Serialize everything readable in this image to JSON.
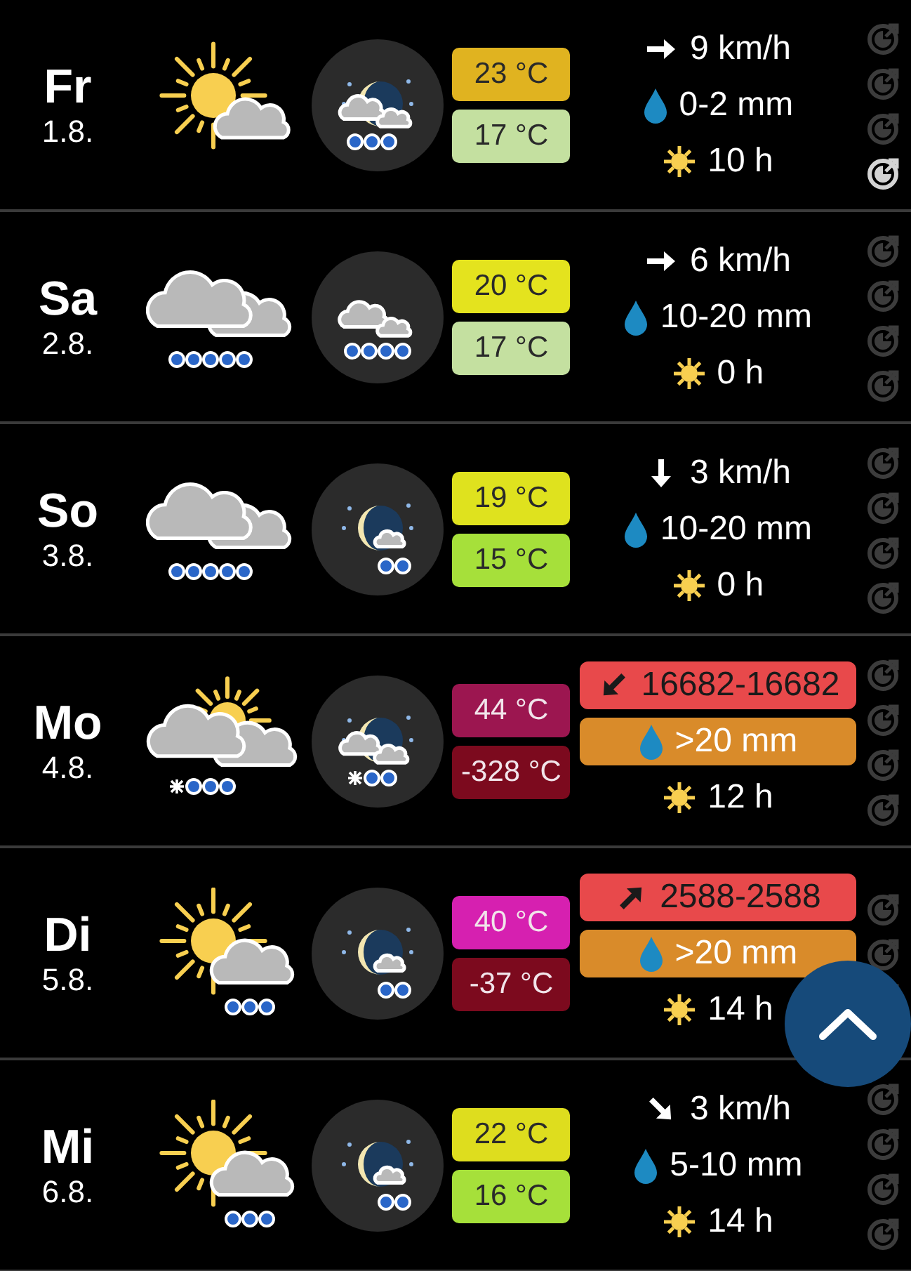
{
  "days": [
    {
      "day": "Fr",
      "date": "1.8.",
      "day_icon": {
        "kind": "sun_cloud"
      },
      "night_icon": {
        "kind": "moon_cloud_rain"
      },
      "high": {
        "text": "23 °C",
        "color": "#e0b320"
      },
      "low": {
        "text": "17 °C",
        "color": "#c4e0a0"
      },
      "wind": {
        "text": "9 km/h",
        "arrow": {
          "kind": "east"
        },
        "alert": false
      },
      "rain": {
        "text": "0-2 mm",
        "alert": false
      },
      "sun": "10 h",
      "markers": [
        {
          "selected": false
        },
        {
          "selected": false
        },
        {
          "selected": false
        },
        {
          "selected": true
        }
      ]
    },
    {
      "day": "Sa",
      "date": "2.8.",
      "day_icon": {
        "kind": "rain_cloud"
      },
      "night_icon": {
        "kind": "cloud_rain"
      },
      "high": {
        "text": "20 °C",
        "color": "#e4e31e"
      },
      "low": {
        "text": "17 °C",
        "color": "#c4e0a0"
      },
      "wind": {
        "text": "6 km/h",
        "arrow": {
          "kind": "east"
        },
        "alert": false
      },
      "rain": {
        "text": "10-20 mm",
        "alert": false
      },
      "sun": "0 h",
      "markers": [
        {
          "selected": false
        },
        {
          "selected": false
        },
        {
          "selected": false
        },
        {
          "selected": false
        }
      ]
    },
    {
      "day": "So",
      "date": "3.8.",
      "day_icon": {
        "kind": "rain_cloud"
      },
      "night_icon": {
        "kind": "moon_rain"
      },
      "high": {
        "text": "19 °C",
        "color": "#dfe21e"
      },
      "low": {
        "text": "15 °C",
        "color": "#a6e03a"
      },
      "wind": {
        "text": "3 km/h",
        "arrow": {
          "kind": "south"
        },
        "alert": false
      },
      "rain": {
        "text": "10-20 mm",
        "alert": false
      },
      "sun": "0 h",
      "markers": [
        {
          "selected": false
        },
        {
          "selected": false
        },
        {
          "selected": false
        },
        {
          "selected": false
        }
      ]
    },
    {
      "day": "Mo",
      "date": "4.8.",
      "day_icon": {
        "kind": "sun_cloud_snow"
      },
      "night_icon": {
        "kind": "moon_cloud_snow"
      },
      "high": {
        "text": "44 °C",
        "color": "#9c1650"
      },
      "low": {
        "text": "-328 °C",
        "color": "#7c0a1e"
      },
      "wind": {
        "text": "16682-16682",
        "arrow": {
          "kind": "southwest"
        },
        "alert": true
      },
      "rain": {
        "text": ">20 mm",
        "alert": true
      },
      "sun": "12 h",
      "markers": [
        {
          "selected": false
        },
        {
          "selected": false
        },
        {
          "selected": false
        },
        {
          "selected": false
        }
      ]
    },
    {
      "day": "Di",
      "date": "5.8.",
      "day_icon": {
        "kind": "sun_cloud_rain"
      },
      "night_icon": {
        "kind": "moon_rain"
      },
      "high": {
        "text": "40 °C",
        "color": "#d620b0"
      },
      "low": {
        "text": "-37 °C",
        "color": "#7c0a1e"
      },
      "wind": {
        "text": "2588-2588",
        "arrow": {
          "kind": "northeast"
        },
        "alert": true
      },
      "rain": {
        "text": ">20 mm",
        "alert": true
      },
      "sun": "14 h",
      "markers": [
        {
          "selected": false
        },
        {
          "selected": false
        },
        {
          "selected": false
        }
      ]
    },
    {
      "day": "Mi",
      "date": "6.8.",
      "day_icon": {
        "kind": "sun_cloud_rain"
      },
      "night_icon": {
        "kind": "moon_rain"
      },
      "high": {
        "text": "22 °C",
        "color": "#dedd1e"
      },
      "low": {
        "text": "16 °C",
        "color": "#a6e03a"
      },
      "wind": {
        "text": "3 km/h",
        "arrow": {
          "kind": "southeast"
        },
        "alert": false
      },
      "rain": {
        "text": "5-10 mm",
        "alert": false
      },
      "sun": "14 h",
      "markers": [
        {
          "selected": false
        },
        {
          "selected": false
        },
        {
          "selected": false
        },
        {
          "selected": false
        }
      ]
    }
  ]
}
